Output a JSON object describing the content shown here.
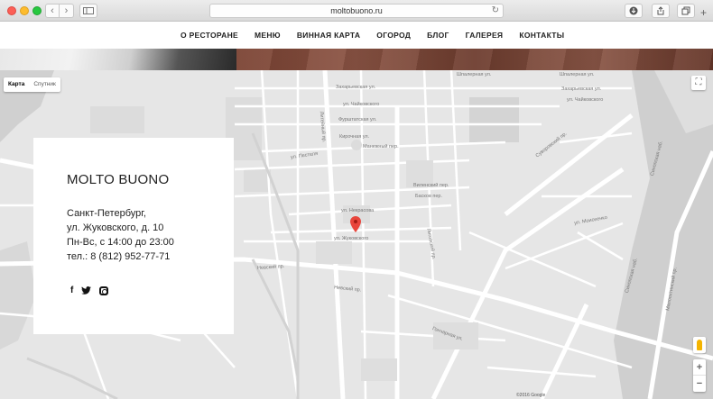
{
  "browser": {
    "url": "moltobuono.ru",
    "back_icon": "‹",
    "forward_icon": "›"
  },
  "nav": {
    "items": [
      "О РЕСТОРАНЕ",
      "МЕНЮ",
      "ВИННАЯ КАРТА",
      "ОГОРОД",
      "БЛОГ",
      "ГАЛЕРЕЯ",
      "КОНТАКТЫ"
    ]
  },
  "map": {
    "type_controls": [
      "Карта",
      "Спутник"
    ],
    "selected_type": "Карта",
    "zoom_in": "+",
    "zoom_out": "−",
    "copyright": "©2016 Google",
    "marker_label": "ул. Жуковского",
    "streets": [
      "Шпалерная ул.",
      "Захарьевская ул.",
      "ул. Чайковского",
      "Фурштатская ул.",
      "Кирочная ул.",
      "Манежный пер.",
      "ул. Пестеля",
      "ул. Некрасова",
      "Виленский пер.",
      "Басков пер.",
      "Суворовский пр.",
      "Лиговский пр.",
      "Невский пр.",
      "Гончарная ул.",
      "Синопская наб.",
      "Малоохтинский пр.",
      "ул. Моисеенко",
      "Литейный пр."
    ]
  },
  "card": {
    "title": "MOLTO BUONO",
    "address_lines": [
      "Санкт-Петербург,",
      "ул. Жуковского, д. 10",
      "Пн-Вс, с 14:00 до 23:00",
      "тел.: 8 (812) 952-77-71"
    ],
    "socials": [
      "facebook-icon",
      "twitter-icon",
      "instagram-icon"
    ],
    "facebook_glyph": "f",
    "twitter_glyph": "🐦"
  }
}
